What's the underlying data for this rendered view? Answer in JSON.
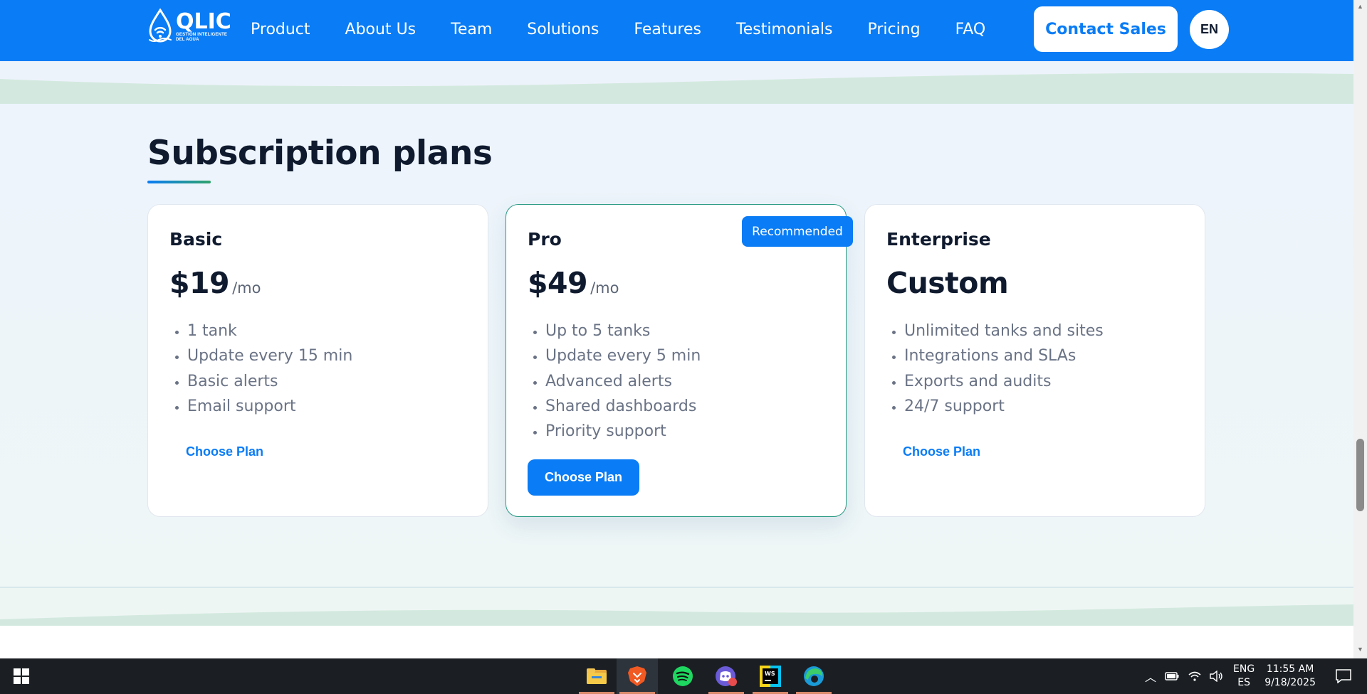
{
  "header": {
    "logo": {
      "name": "QLIC",
      "tagline_line1": "GESTIÓN INTELIGENTE",
      "tagline_line2": "DEL AGUA"
    },
    "nav": [
      "Product",
      "About Us",
      "Team",
      "Solutions",
      "Features",
      "Testimonials",
      "Pricing",
      "FAQ"
    ],
    "contact_label": "Contact Sales",
    "language": "EN"
  },
  "section": {
    "title": "Subscription plans",
    "plans": [
      {
        "name": "Basic",
        "price": "$19",
        "unit": "/mo",
        "features": [
          "1 tank",
          "Update every 15 min",
          "Basic alerts",
          "Email support"
        ],
        "cta": "Choose Plan"
      },
      {
        "name": "Pro",
        "price": "$49",
        "unit": "/mo",
        "badge": "Recommended",
        "features": [
          "Up to 5 tanks",
          "Update every 5 min",
          "Advanced alerts",
          "Shared dashboards",
          "Priority support"
        ],
        "cta": "Choose Plan"
      },
      {
        "name": "Enterprise",
        "price": "Custom",
        "features": [
          "Unlimited tanks and sites",
          "Integrations and SLAs",
          "Exports and audits",
          "24/7 support"
        ],
        "cta": "Choose Plan"
      }
    ]
  },
  "colors": {
    "brand_blue": "#0a7cf5",
    "dark_text": "#0f1a2e",
    "muted_text": "#6a7385",
    "accent_green": "#2b9b84",
    "wave_green": "#d3e9df"
  },
  "taskbar": {
    "apps": [
      "file-explorer",
      "brave-browser",
      "spotify",
      "discord",
      "webstorm",
      "edge"
    ],
    "tray": {
      "language_top": "ENG",
      "language_bottom": "ES",
      "time": "11:55 AM",
      "date": "9/18/2025"
    }
  }
}
